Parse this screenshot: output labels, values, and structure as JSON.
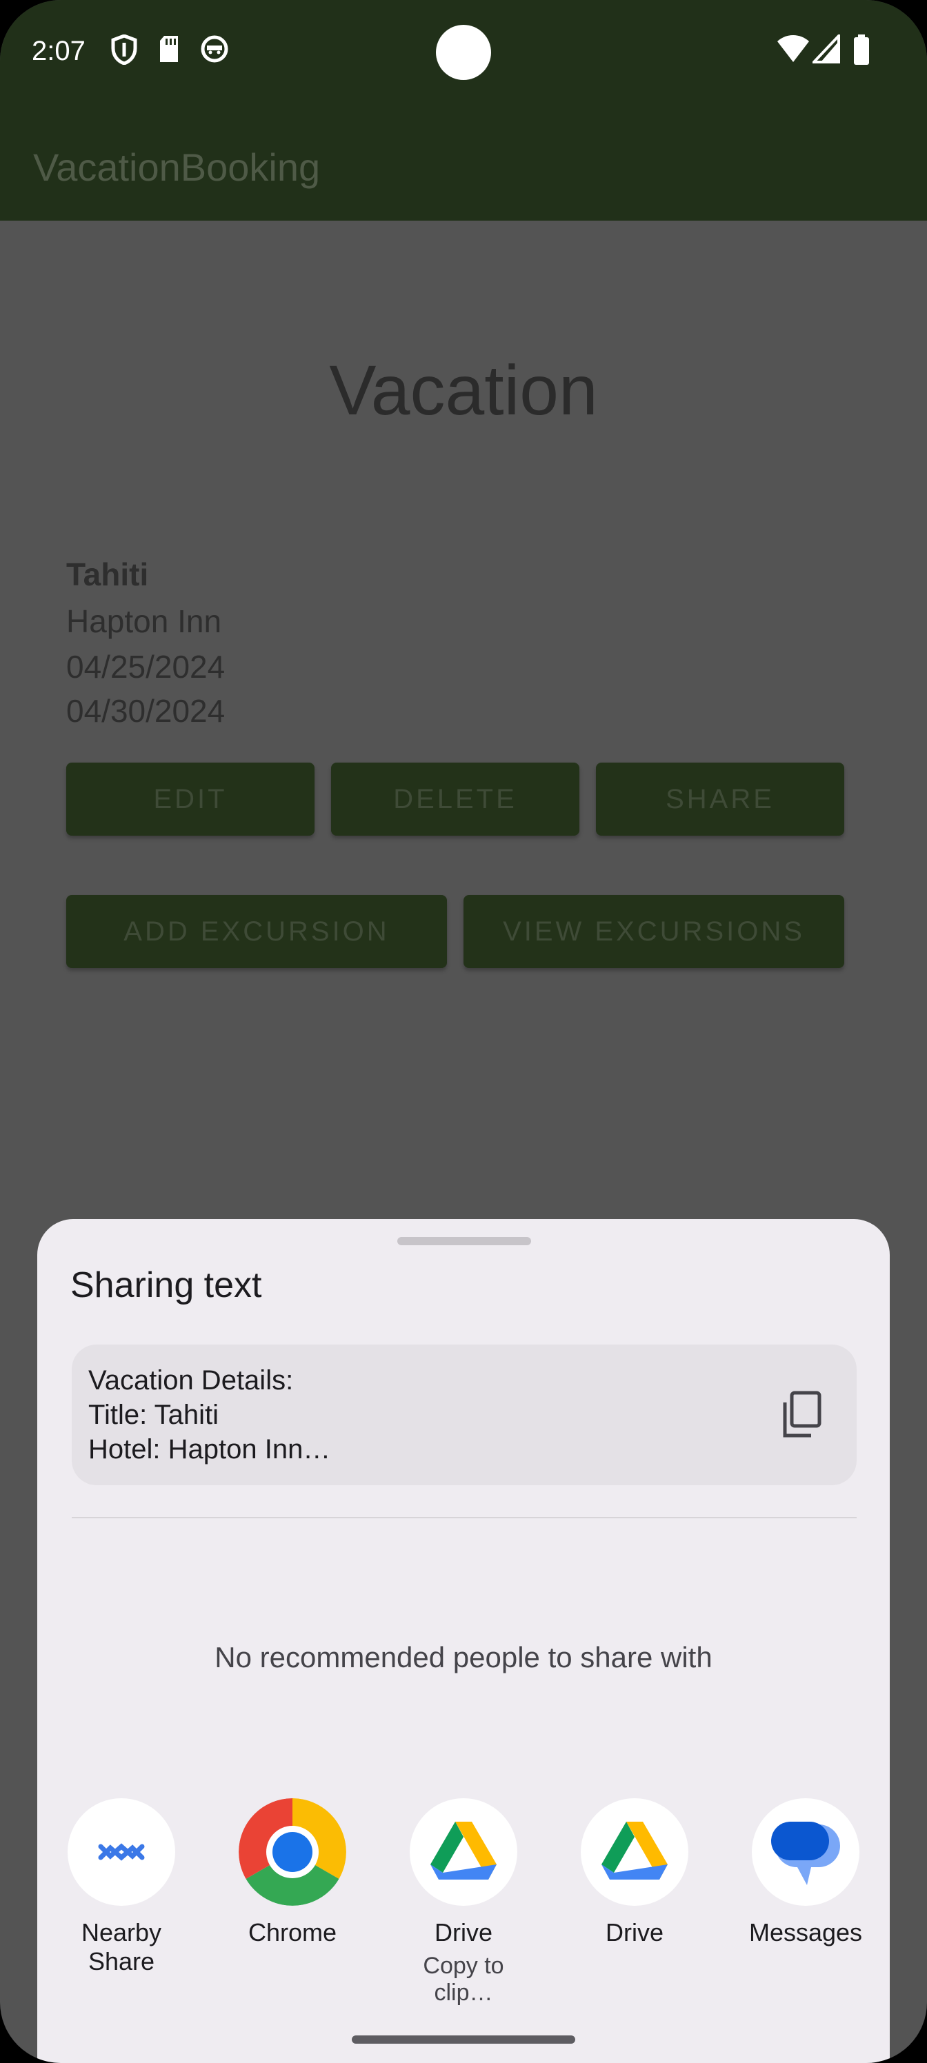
{
  "status_bar": {
    "time": "2:07"
  },
  "app_bar": {
    "title": "VacationBooking"
  },
  "vacation": {
    "heading": "Vacation",
    "title": "Tahiti",
    "hotel": "Hapton Inn",
    "start_date": "04/25/2024",
    "end_date": "04/30/2024",
    "buttons": {
      "edit": "EDIT",
      "delete": "DELETE",
      "share": "SHARE",
      "add_excursion": "ADD EXCURSION",
      "view_excursions": "VIEW EXCURSIONS"
    }
  },
  "share_sheet": {
    "title": "Sharing text",
    "preview_lines": [
      "Vacation Details:",
      "Title: Tahiti",
      "Hotel: Hapton Inn…"
    ],
    "empty_message": "No recommended people to share with",
    "targets": [
      {
        "label": "Nearby Share",
        "icon": "nearby-share-icon"
      },
      {
        "label": "Chrome",
        "icon": "chrome-icon"
      },
      {
        "label": "Drive",
        "sublabel": "Copy to clip…",
        "icon": "drive-icon"
      },
      {
        "label": "Drive",
        "icon": "drive-icon"
      },
      {
        "label": "Messages",
        "icon": "messages-icon"
      }
    ]
  },
  "colors": {
    "app_bar": "#213019",
    "button": "#233219",
    "scrim": "#545454",
    "sheet": "#efecf1"
  }
}
